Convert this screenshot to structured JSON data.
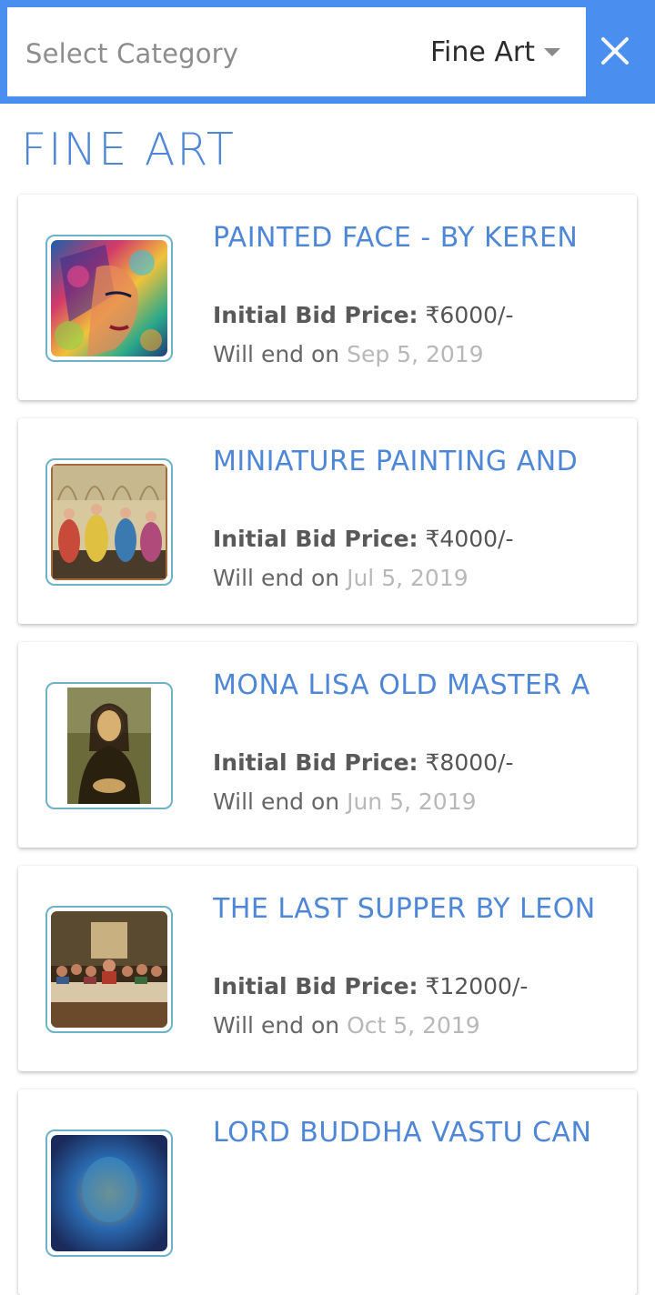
{
  "header": {
    "select_placeholder": "Select Category",
    "selected_value": "Fine Art",
    "close_icon": "close-icon",
    "accent": "#4a8ef0"
  },
  "page_title": "FINE ART",
  "labels": {
    "price_label": "Initial Bid Price:",
    "end_label": "Will end on"
  },
  "items": [
    {
      "title": "PAINTED FACE - BY KEREN",
      "price": "₹6000/-",
      "end_date": "Sep 5, 2019",
      "image": "painted-face-image"
    },
    {
      "title": "MINIATURE PAINTING AND",
      "price": "₹4000/-",
      "end_date": "Jul 5, 2019",
      "image": "miniature-painting-image"
    },
    {
      "title": "MONA LISA OLD MASTER A",
      "price": "₹8000/-",
      "end_date": "Jun 5, 2019",
      "image": "mona-lisa-image"
    },
    {
      "title": "THE LAST SUPPER BY LEON",
      "price": "₹12000/-",
      "end_date": "Oct 5, 2019",
      "image": "last-supper-image"
    },
    {
      "title": "LORD BUDDHA VASTU CAN",
      "price": "",
      "end_date": "",
      "image": "buddha-image"
    }
  ]
}
